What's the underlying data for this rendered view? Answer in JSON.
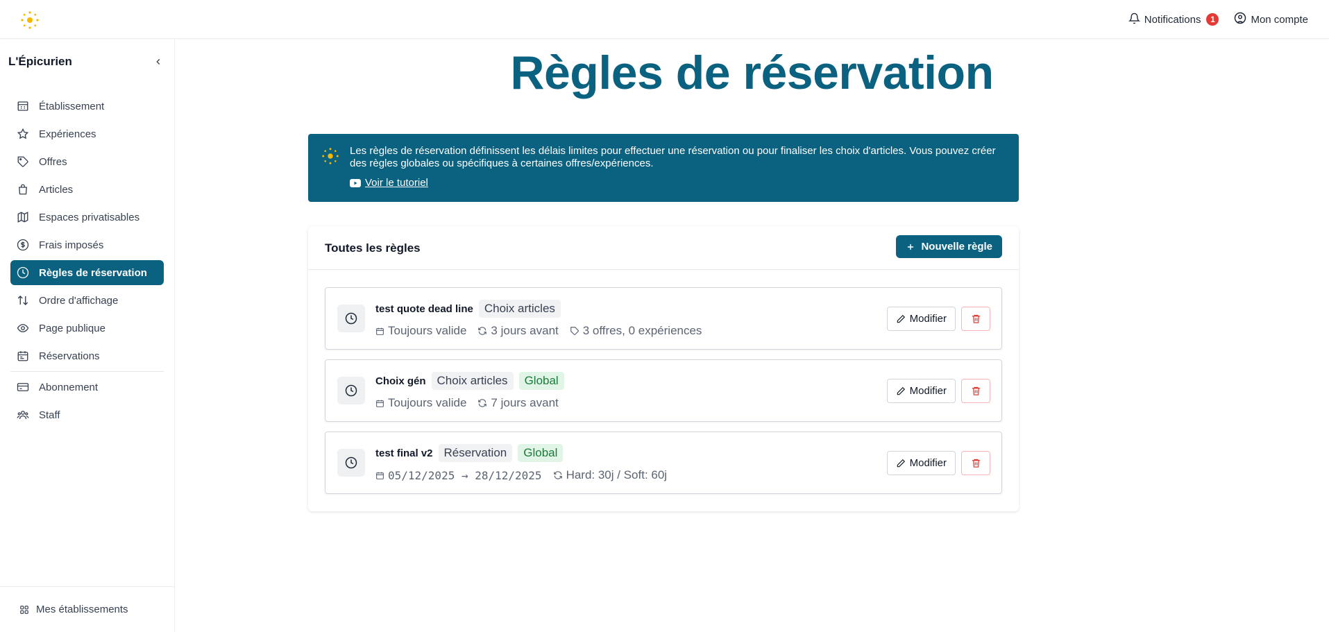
{
  "topbar": {
    "notifications_label": "Notifications",
    "notifications_count": "1",
    "account_label": "Mon compte"
  },
  "sidebar": {
    "brand": "L'Épicurien",
    "items": [
      {
        "label": "Établissement",
        "icon": "building-icon"
      },
      {
        "label": "Expériences",
        "icon": "star-icon"
      },
      {
        "label": "Offres",
        "icon": "tag-icon"
      },
      {
        "label": "Articles",
        "icon": "bag-icon"
      },
      {
        "label": "Espaces privatisables",
        "icon": "map-icon"
      },
      {
        "label": "Frais imposés",
        "icon": "dollar-icon"
      },
      {
        "label": "Règles de réservation",
        "icon": "clock-icon",
        "active": true
      },
      {
        "label": "Ordre d'affichage",
        "icon": "sort-arrows-icon"
      },
      {
        "label": "Page publique",
        "icon": "eye-icon"
      },
      {
        "label": "Réservations",
        "icon": "calendar-icon"
      },
      {
        "label": "Abonnement",
        "icon": "card-icon"
      },
      {
        "label": "Staff",
        "icon": "users-icon"
      }
    ],
    "footer_label": "Mes établissements"
  },
  "page": {
    "title": "Règles de réservation"
  },
  "info": {
    "text": "Les règles de réservation définissent les délais limites pour effectuer une réservation ou pour finaliser les choix d'articles. Vous pouvez créer des règles globales ou spécifiques à certaines offres/expériences.",
    "link_label": "Voir le tutoriel"
  },
  "rules_card": {
    "title": "Toutes les règles",
    "new_button": "Nouvelle règle",
    "edit_label": "Modifier",
    "rules": [
      {
        "name": "test quote dead line",
        "type_tag": "Choix articles",
        "validity": "Toujours valide",
        "delay": "3 jours avant",
        "scope": "3 offres, 0 expériences"
      },
      {
        "name": "Choix gén",
        "type_tag": "Choix articles",
        "global_tag": "Global",
        "validity": "Toujours valide",
        "delay": "7 jours avant"
      },
      {
        "name": "test final v2",
        "type_tag": "Réservation",
        "global_tag": "Global",
        "validity": "05/12/2025 → 28/12/2025",
        "delay": "Hard: 30j / Soft: 60j"
      }
    ]
  },
  "colors": {
    "primary": "#0b6180",
    "accent_yellow": "#f5b800",
    "danger": "#e53935",
    "global_tag_bg": "#e0f5e6"
  }
}
